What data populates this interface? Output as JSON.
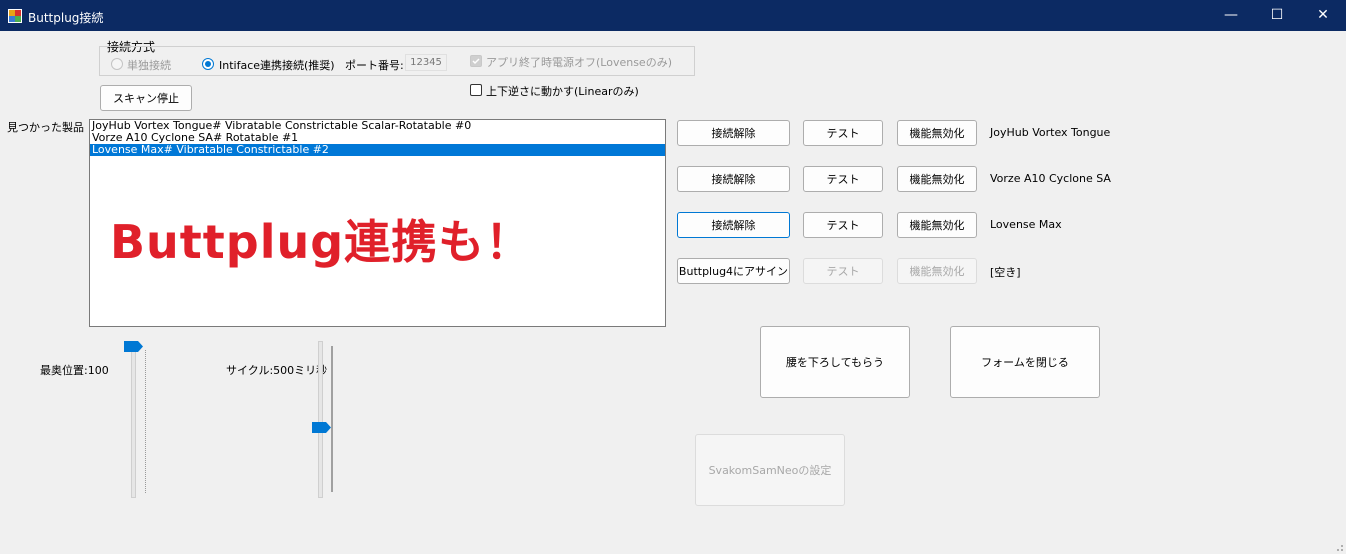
{
  "window": {
    "title": "Buttplug接続",
    "minimize_glyph": "—",
    "maximize_glyph": "☐",
    "close_glyph": "✕"
  },
  "connection": {
    "group_label": "接続方式",
    "radio_single": "単独接続",
    "radio_intiface": "Intiface連携接続(推奨)",
    "port_label": "ポート番号:",
    "port_value": "12345",
    "check_poweroff": "アプリ終了時電源オフ(Lovenseのみ)",
    "check_reverse": "上下逆さに動かす(Linearのみ)"
  },
  "scan_button": "スキャン停止",
  "found_label": "見つかった製品",
  "devices_list": [
    "JoyHub Vortex Tongue# Vibratable  Constrictable  Scalar-Rotatable #0",
    "Vorze A10 Cyclone SA# Rotatable #1",
    "Lovense Max# Vibratable  Constrictable #2"
  ],
  "overlay_text": "Buttplug連携も！",
  "device_rows": [
    {
      "action": "接続解除",
      "test": "テスト",
      "disable": "機能無効化",
      "name": "JoyHub Vortex Tongue"
    },
    {
      "action": "接続解除",
      "test": "テスト",
      "disable": "機能無効化",
      "name": "Vorze A10 Cyclone SA"
    },
    {
      "action": "接続解除",
      "test": "テスト",
      "disable": "機能無効化",
      "name": "Lovense Max"
    },
    {
      "action": "Buttplug4にアサイン",
      "test": "テスト",
      "disable": "機能無効化",
      "name": "[空き]"
    }
  ],
  "sliders": {
    "depth_label": "最奥位置:100",
    "cycle_label": "サイクル:500ミリ秒"
  },
  "buttons": {
    "sit": "腰を下ろしてもらう",
    "close": "フォームを閉じる",
    "svakom": "SvakomSamNeoの設定"
  },
  "colors": {
    "titlebar": "#0c2a63",
    "accent": "#0078d4",
    "overlay": "#e0202a"
  }
}
